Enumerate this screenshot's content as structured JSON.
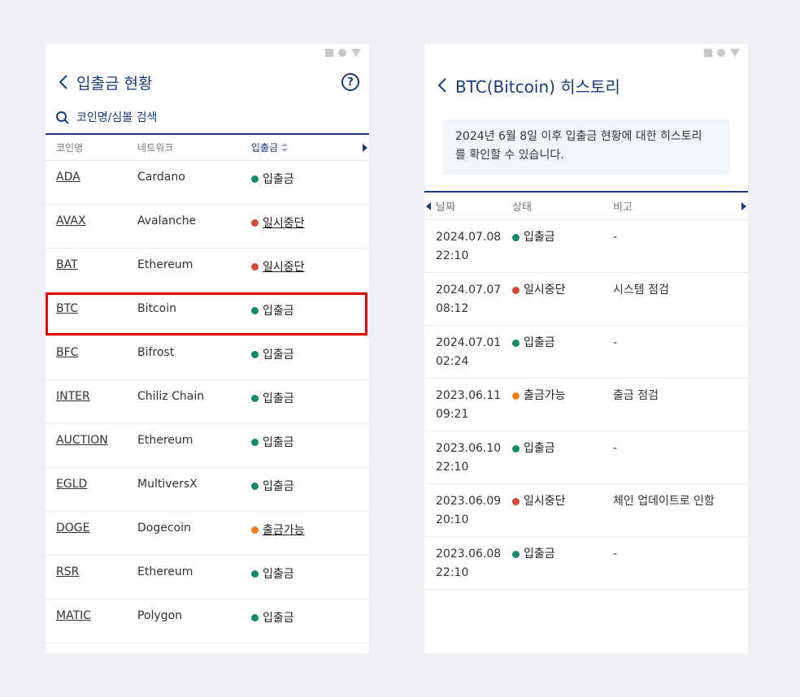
{
  "colors": {
    "primary": "#1a3a7a",
    "green": "#12896b",
    "red": "#d24a3a",
    "orange": "#ef7e21",
    "highlight": "#e00000"
  },
  "left": {
    "title": "입출금 현황",
    "help_icon": "question-circle-icon",
    "search_placeholder": "코인명/심볼 검색",
    "columns": [
      "코인명",
      "네트워크",
      "입출금"
    ],
    "rows": [
      {
        "symbol": "ADA",
        "network": "Cardano",
        "status": "입출금",
        "color": "green"
      },
      {
        "symbol": "AVAX",
        "network": "Avalanche",
        "status": "일시중단",
        "color": "red"
      },
      {
        "symbol": "BAT",
        "network": "Ethereum",
        "status": "일시중단",
        "color": "red"
      },
      {
        "symbol": "BTC",
        "network": "Bitcoin",
        "status": "입출금",
        "color": "green"
      },
      {
        "symbol": "BFC",
        "network": "Bifrost",
        "status": "입출금",
        "color": "green"
      },
      {
        "symbol": "INTER",
        "network": "Chiliz Chain",
        "status": "입출금",
        "color": "green"
      },
      {
        "symbol": "AUCTION",
        "network": "Ethereum",
        "status": "입출금",
        "color": "green"
      },
      {
        "symbol": "EGLD",
        "network": "MultiversX",
        "status": "입출금",
        "color": "green"
      },
      {
        "symbol": "DOGE",
        "network": "Dogecoin",
        "status": "출금가능",
        "color": "orange"
      },
      {
        "symbol": "RSR",
        "network": "Ethereum",
        "status": "입출금",
        "color": "green"
      },
      {
        "symbol": "MATIC",
        "network": "Polygon",
        "status": "입출금",
        "color": "green"
      }
    ]
  },
  "right": {
    "title": "BTC(Bitcoin) 히스토리",
    "notice_line1": "2024년 6월 8일 이후 입출금 현황에 대한 히스토리",
    "notice_line2": "를 확인할 수 있습니다.",
    "columns": [
      "날짜",
      "상태",
      "비고"
    ],
    "rows": [
      {
        "date": "2024.07.08",
        "time": "22:10",
        "status": "입출금",
        "color": "green",
        "note": "-"
      },
      {
        "date": "2024.07.07",
        "time": "08:12",
        "status": "일시중단",
        "color": "red",
        "note": "시스템 점검"
      },
      {
        "date": "2024.07.01",
        "time": "02:24",
        "status": "입출금",
        "color": "green",
        "note": "-"
      },
      {
        "date": "2023.06.11",
        "time": "09:21",
        "status": "출금가능",
        "color": "orange",
        "note": "출금 점검"
      },
      {
        "date": "2023.06.10",
        "time": "22:10",
        "status": "입출금",
        "color": "green",
        "note": "-"
      },
      {
        "date": "2023.06.09",
        "time": "20:10",
        "status": "일시중단",
        "color": "red",
        "note": "체인 업데이트로 인함"
      },
      {
        "date": "2023.06.08",
        "time": "22:10",
        "status": "입출금",
        "color": "green",
        "note": "-"
      }
    ]
  }
}
